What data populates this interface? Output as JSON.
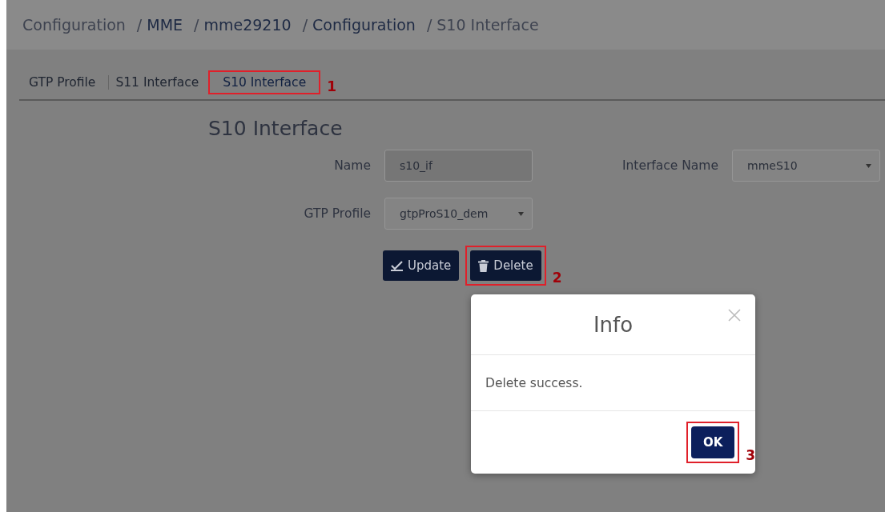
{
  "breadcrumb": {
    "separator": "/",
    "items": [
      {
        "label": "Configuration",
        "link": false
      },
      {
        "label": "MME",
        "link": true
      },
      {
        "label": "mme29210",
        "link": true
      },
      {
        "label": "Configuration",
        "link": true
      },
      {
        "label": "S10 Interface",
        "link": false
      }
    ]
  },
  "tabs": [
    {
      "label": "GTP Profile",
      "selected": false
    },
    {
      "label": "S11 Interface",
      "selected": false
    },
    {
      "label": "S10 Interface",
      "selected": true,
      "callout": "1"
    }
  ],
  "form": {
    "title": "S10 Interface",
    "fields": [
      {
        "label": "Name",
        "kind": "text",
        "value": "s10_if",
        "disabled": true
      },
      {
        "label": "Interface Name",
        "kind": "select",
        "value": "mmeS10",
        "disabled": false
      },
      {
        "label": "GTP Profile",
        "kind": "select",
        "value": "gtpProS10_dem",
        "disabled": false
      }
    ],
    "buttons": [
      {
        "label": "Update",
        "kind": "update"
      },
      {
        "label": "Delete",
        "kind": "delete",
        "callout": "2"
      }
    ]
  },
  "dialog": {
    "title": "Info",
    "message": "Delete success.",
    "button": {
      "label": "OK",
      "callout": "3"
    }
  }
}
